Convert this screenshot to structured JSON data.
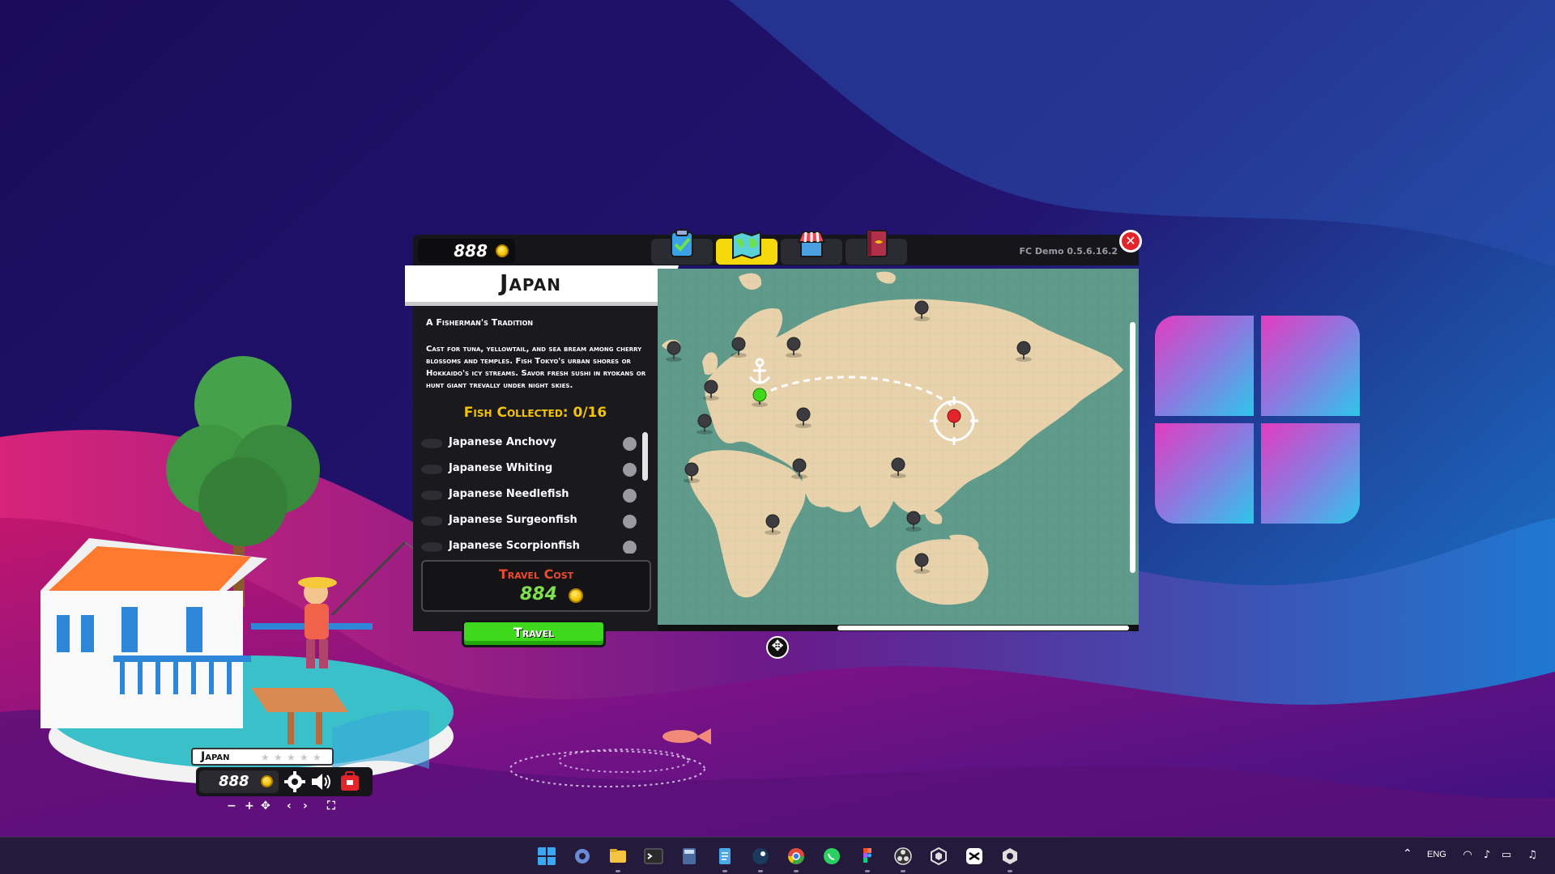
{
  "game": {
    "coins": "888",
    "version": "FC Demo 0.5.6.16.2",
    "tabs": [
      {
        "name": "tasks",
        "icon": "clipboard-check-icon",
        "active": false
      },
      {
        "name": "map",
        "icon": "world-map-icon",
        "active": true
      },
      {
        "name": "shop",
        "icon": "shop-icon",
        "active": false
      },
      {
        "name": "book",
        "icon": "fish-book-icon",
        "active": false
      }
    ],
    "close_icon": "close-icon",
    "location": {
      "title": "Japan",
      "subtitle": "A Fisherman's Tradition",
      "description": "Cast for tuna, yellowtail, and sea bream among cherry blossoms and temples. Fish Tokyo's urban shores or Hokkaido's icy streams. Savor fresh sushi in ryokans or hunt giant trevally under night skies.",
      "fish_collected": "Fish Collected: 0/16"
    },
    "fish": [
      {
        "name": "Japanese Anchovy",
        "caught": false
      },
      {
        "name": "Japanese Whiting",
        "caught": false
      },
      {
        "name": "Japanese Needlefish",
        "caught": false
      },
      {
        "name": "Japanese Surgeonfish",
        "caught": false
      },
      {
        "name": "Japanese Scorpionfish",
        "caught": false
      }
    ],
    "travel_cost_label": "Travel Cost",
    "travel_cost": "884",
    "travel_button": "Travel",
    "map": {
      "current_marker": "green-pin-icon",
      "selected_marker": "red-pin-icon",
      "port_icon": "anchor-icon"
    },
    "mini_hud": {
      "location": "Japan",
      "coins": "888",
      "stars_filled": 0,
      "stars_total": 5
    }
  },
  "taskbar": {
    "apps": [
      "start-icon",
      "settings-icon",
      "file-explorer-icon",
      "terminal-icon",
      "calculator-icon",
      "notepad-icon",
      "steam-icon",
      "chrome-icon",
      "whatsapp-icon",
      "figma-icon",
      "obs-icon",
      "unity-icon",
      "capcut-icon",
      "fishing-game-icon"
    ],
    "language": "ENG"
  },
  "colors": {
    "accent_yellow": "#f5d90a",
    "travel_green": "#3ed81c",
    "cost_red": "#f04a2e",
    "collected_gold": "#f5c400",
    "map_sea": "#5f9a8a",
    "map_land": "#e7d2ab"
  }
}
